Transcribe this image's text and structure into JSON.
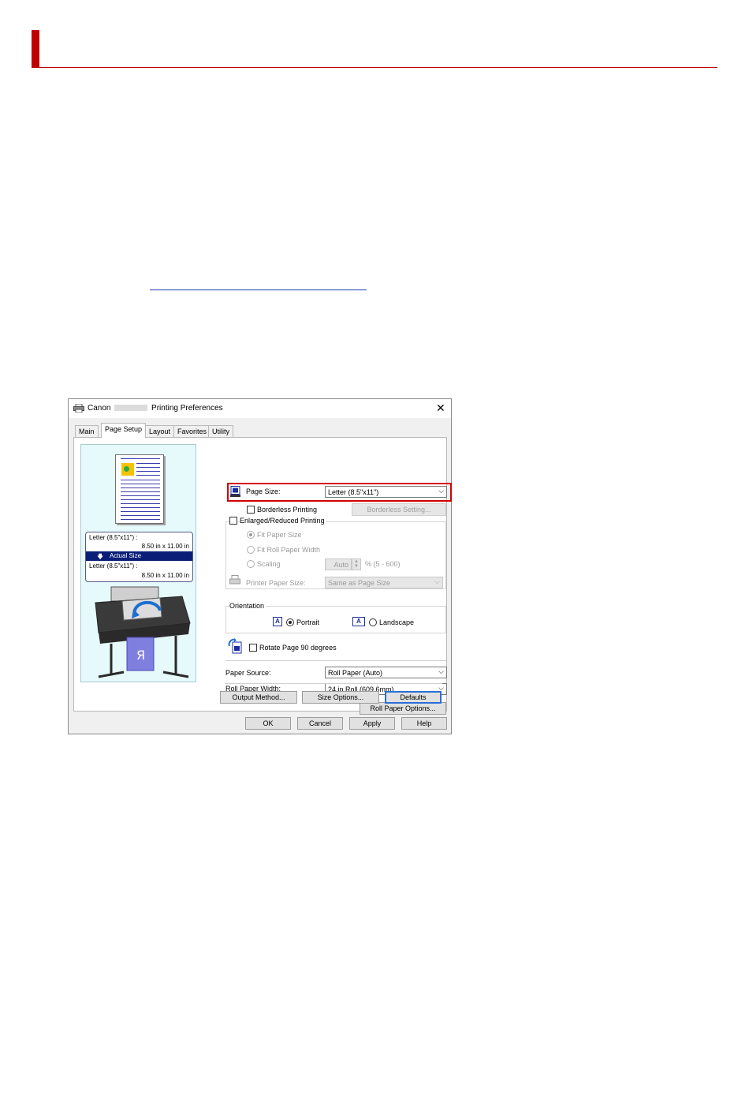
{
  "colors": {
    "brand_red": "#c00000",
    "highlight_red": "#d40000",
    "accent_blue": "#0a1e78"
  },
  "dialog": {
    "title_prefix": "Canon",
    "title_suffix": "Printing Preferences",
    "close_icon": "close-icon",
    "tabs": [
      {
        "label": "Main"
      },
      {
        "label": "Page Setup"
      },
      {
        "label": "Layout"
      },
      {
        "label": "Favorites"
      },
      {
        "label": "Utility"
      }
    ],
    "preview": {
      "size_line1": "Letter (8.5\"x11\") :",
      "size_line2": "8.50 in x 11.00 in",
      "band_label": "Actual Size",
      "size_line3": "Letter (8.5\"x11\") :",
      "size_line4": "8.50 in x 11.00 in"
    },
    "page_size": {
      "label": "Page Size:",
      "value": "Letter (8.5\"x11\")"
    },
    "borderless": {
      "label": "Borderless Printing",
      "button": "Borderless Setting..."
    },
    "enlarged": {
      "label": "Enlarged/Reduced Printing"
    },
    "fit_paper_size": "Fit Paper Size",
    "fit_roll_width": "Fit Roll Paper Width",
    "scaling": {
      "label": "Scaling",
      "value": "Auto",
      "range": "% (5 - 600)"
    },
    "printer_paper_size": {
      "label": "Printer Paper Size:",
      "value": "Same as Page Size"
    },
    "orientation": {
      "label": "Orientation",
      "portrait": "Portrait",
      "landscape": "Landscape"
    },
    "rotate": {
      "label": "Rotate Page 90 degrees"
    },
    "paper_source": {
      "label": "Paper Source:",
      "value": "Roll Paper (Auto)"
    },
    "roll_width": {
      "label": "Roll Paper Width:",
      "value": "24 in Roll (609.6mm)"
    },
    "roll_options_button": "Roll Paper Options...",
    "output_method_button": "Output Method...",
    "size_options_button": "Size Options...",
    "defaults_button": "Defaults",
    "ok_button": "OK",
    "cancel_button": "Cancel",
    "apply_button": "Apply",
    "help_button": "Help"
  }
}
